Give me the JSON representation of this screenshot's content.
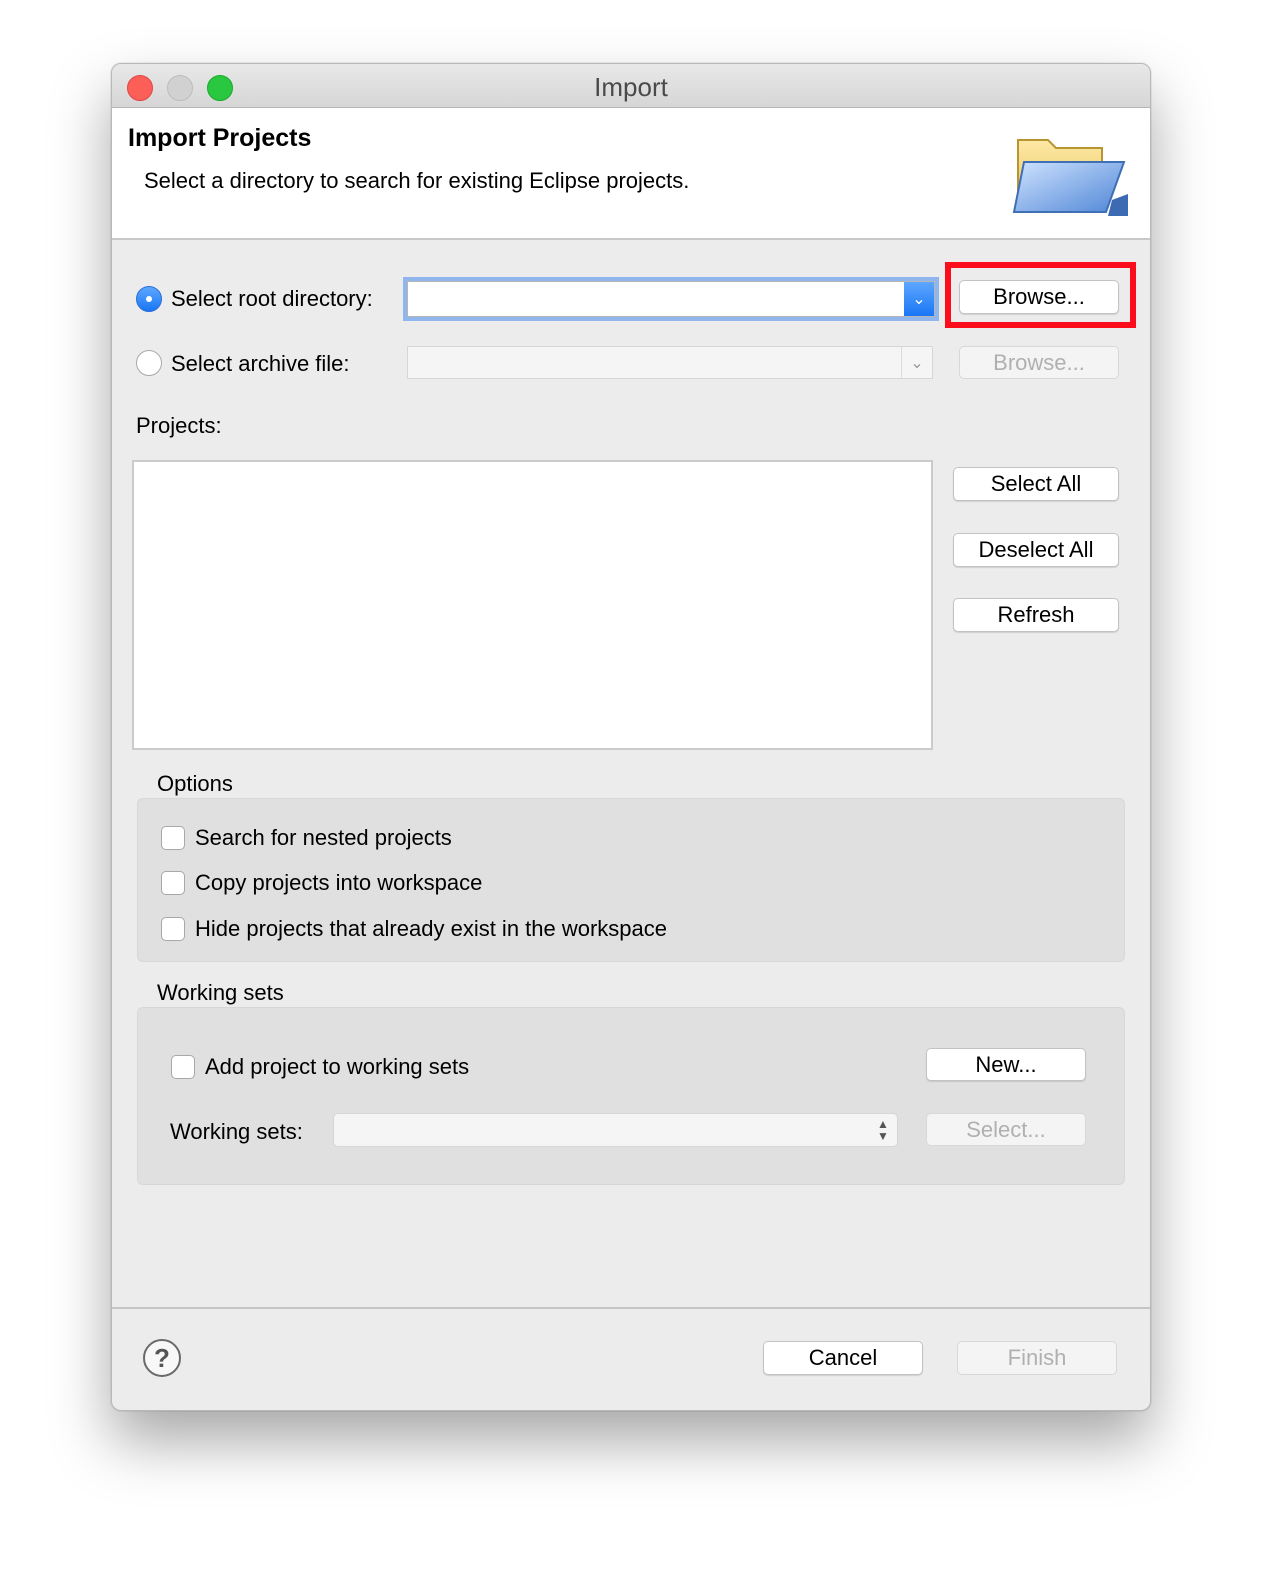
{
  "window": {
    "title": "Import"
  },
  "header": {
    "title": "Import Projects",
    "description": "Select a directory to search for existing Eclipse projects.",
    "icon": "open-folder-icon"
  },
  "source": {
    "root_directory_label": "Select root directory:",
    "root_directory_value": "",
    "root_directory_selected": true,
    "archive_file_label": "Select archive file:",
    "archive_file_value": "",
    "browse_label": "Browse...",
    "browse_archive_label": "Browse..."
  },
  "projects": {
    "label": "Projects:",
    "items": [],
    "select_all_label": "Select All",
    "deselect_all_label": "Deselect All",
    "refresh_label": "Refresh"
  },
  "options": {
    "title": "Options",
    "nested_label": "Search for nested projects",
    "copy_label": "Copy projects into workspace",
    "hide_label": "Hide projects that already exist in the workspace"
  },
  "working_sets": {
    "title": "Working sets",
    "add_label": "Add project to working sets",
    "new_label": "New...",
    "sets_label": "Working sets:",
    "sets_value": "",
    "select_label": "Select..."
  },
  "footer": {
    "cancel_label": "Cancel",
    "finish_label": "Finish"
  },
  "colors": {
    "highlight": "#fb0d1b",
    "accent": "#1976f5"
  }
}
